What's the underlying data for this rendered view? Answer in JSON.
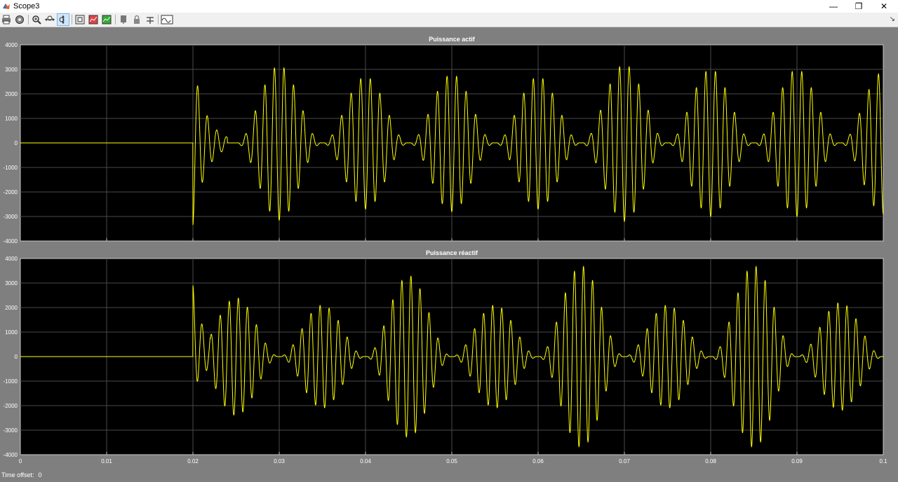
{
  "window": {
    "title": "Scope3",
    "minimize_glyph": "—",
    "restore_glyph": "❐",
    "close_glyph": "✕"
  },
  "toolbar": {
    "items": [
      {
        "icon": "print-icon"
      },
      {
        "icon": "settings-icon"
      },
      {
        "icon": "zoom-in-icon"
      },
      {
        "icon": "zoom-x-icon"
      },
      {
        "icon": "zoom-y-icon",
        "active": true
      },
      {
        "icon": "autoscale-icon"
      },
      {
        "icon": "save-axes-icon"
      },
      {
        "icon": "restore-axes-icon"
      },
      {
        "icon": "floating-scope-icon"
      },
      {
        "icon": "lock-icon"
      },
      {
        "icon": "signal-selection-icon"
      },
      {
        "icon": "measurements-icon"
      }
    ],
    "chevron_glyph": "↘"
  },
  "footer": {
    "label": "Time offset:",
    "value": "0"
  },
  "colors": {
    "figure_background": "#7f7f7f",
    "axes_background": "#000000",
    "grid": "#4a4a4a",
    "trace": "#ffff00",
    "text": "#ffffff"
  },
  "chart_data": [
    {
      "type": "line",
      "title": "Puissance actif",
      "xlim": [
        0,
        0.1
      ],
      "ylim": [
        -4000,
        4000
      ],
      "xticks": [
        0,
        0.01,
        0.02,
        0.03,
        0.04,
        0.05,
        0.06,
        0.07,
        0.08,
        0.09,
        0.1
      ],
      "yticks": [
        -4000,
        -3000,
        -2000,
        -1000,
        0,
        1000,
        2000,
        3000,
        4000
      ],
      "grid": true,
      "show_xtick_labels": false,
      "signal": {
        "step_time": 0.02,
        "value_before_step": 0,
        "oscillation_frequency_hz": 900,
        "envelope_period_s": 0.01,
        "initial_transient_peak": 3350,
        "envelope_peaks": [
          {
            "t": 0.03,
            "amplitude": 3150
          },
          {
            "t": 0.04,
            "amplitude": 2700
          },
          {
            "t": 0.05,
            "amplitude": 2800
          },
          {
            "t": 0.06,
            "amplitude": 2700
          },
          {
            "t": 0.07,
            "amplitude": 3200
          },
          {
            "t": 0.08,
            "amplitude": 3000
          },
          {
            "t": 0.09,
            "amplitude": 3000
          },
          {
            "t": 0.1,
            "amplitude": 2900
          }
        ]
      }
    },
    {
      "type": "line",
      "title": "Puissance réactif",
      "xlim": [
        0,
        0.1
      ],
      "ylim": [
        -4000,
        4000
      ],
      "xticks": [
        0,
        0.01,
        0.02,
        0.03,
        0.04,
        0.05,
        0.06,
        0.07,
        0.08,
        0.09,
        0.1
      ],
      "yticks": [
        -4000,
        -3000,
        -2000,
        -1000,
        0,
        1000,
        2000,
        3000,
        4000
      ],
      "grid": true,
      "show_xtick_labels": true,
      "signal": {
        "step_time": 0.02,
        "value_before_step": 0,
        "oscillation_frequency_hz": 950,
        "envelope_period_s": 0.01,
        "initial_transient_peak": 2100,
        "envelope_peaks": [
          {
            "t": 0.025,
            "amplitude": 2400
          },
          {
            "t": 0.035,
            "amplitude": 2100
          },
          {
            "t": 0.045,
            "amplitude": 3300
          },
          {
            "t": 0.055,
            "amplitude": 2100
          },
          {
            "t": 0.065,
            "amplitude": 3700
          },
          {
            "t": 0.075,
            "amplitude": 2100
          },
          {
            "t": 0.085,
            "amplitude": 3700
          },
          {
            "t": 0.095,
            "amplitude": 2200
          }
        ]
      }
    }
  ]
}
